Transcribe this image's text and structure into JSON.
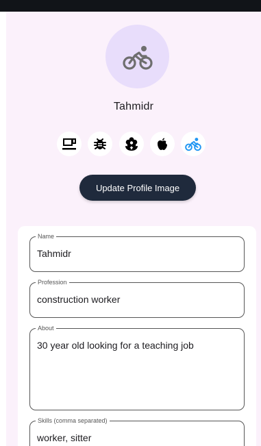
{
  "profile": {
    "username": "Tahmidr",
    "avatar_icon": "bicycle-icon",
    "avatar_bg": "#e8ddfb",
    "avatar_icon_color": "#6e6e6e"
  },
  "icon_options": [
    {
      "icon": "coffee-cup-icon",
      "selected": false
    },
    {
      "icon": "bug-icon",
      "selected": false
    },
    {
      "icon": "flower-icon",
      "selected": false
    },
    {
      "icon": "apple-icon",
      "selected": false
    },
    {
      "icon": "bicycle-icon",
      "selected": true
    }
  ],
  "actions": {
    "update_image_label": "Update Profile Image"
  },
  "form": {
    "name": {
      "label": "Name",
      "value": "Tahmidr"
    },
    "profession": {
      "label": "Profession",
      "value": "construction worker"
    },
    "about": {
      "label": "About",
      "value": "30 year old looking for a teaching job"
    },
    "skills": {
      "label": "Skills (comma separated)",
      "value": "worker, sitter"
    }
  },
  "colors": {
    "background": "#fbf1fb",
    "primary_button": "#1f2a3c",
    "selected_icon": "#2196f3",
    "top_bar": "#111418"
  }
}
